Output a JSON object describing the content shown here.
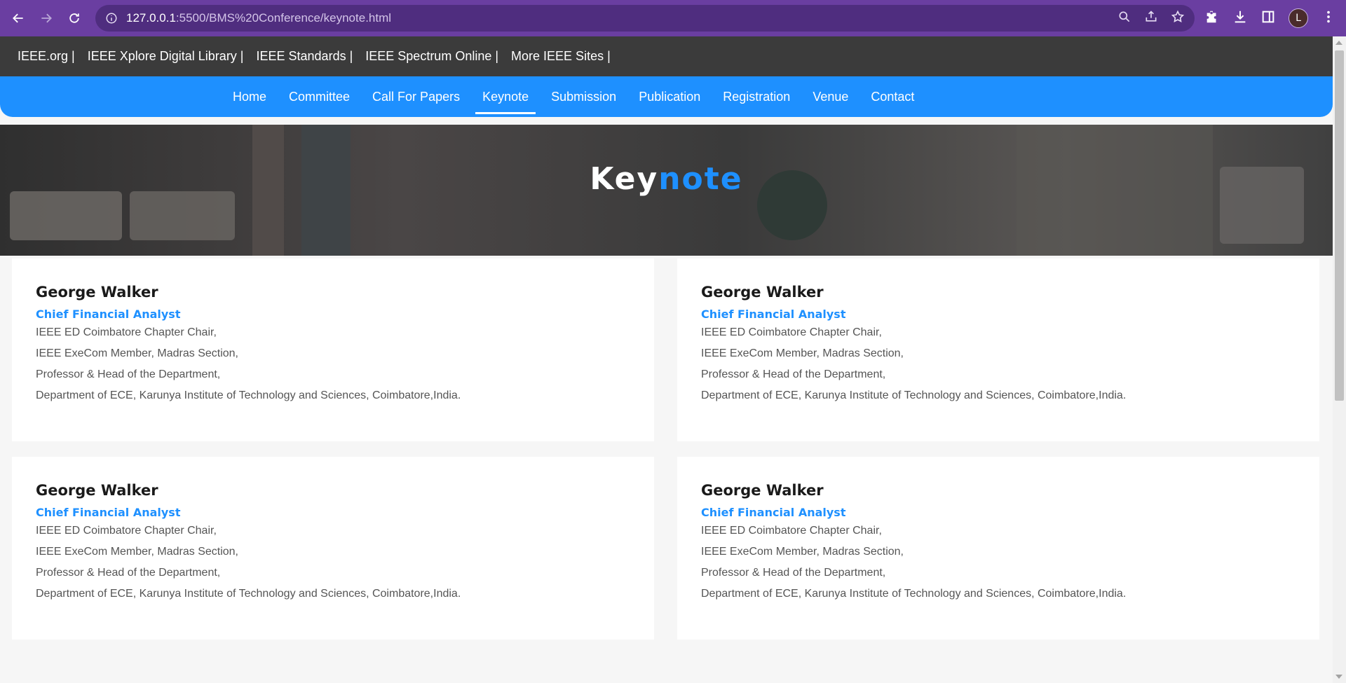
{
  "browser": {
    "url_host": "127.0.0.1",
    "url_path": ":5500/BMS%20Conference/keynote.html",
    "avatar_letter": "L"
  },
  "topbar": {
    "links": [
      "IEEE.org |",
      "IEEE Xplore Digital Library |",
      "IEEE Standards |",
      "IEEE Spectrum Online |",
      "More IEEE Sites |"
    ]
  },
  "nav": {
    "items": [
      "Home",
      "Committee",
      "Call For Papers",
      "Keynote",
      "Submission",
      "Publication",
      "Registration",
      "Venue",
      "Contact"
    ],
    "active": "Keynote"
  },
  "hero": {
    "title_white": "Key",
    "title_blue": "note"
  },
  "speakers": [
    {
      "name": "George Walker",
      "role": "Chief Financial Analyst",
      "lines": [
        "IEEE ED Coimbatore Chapter Chair,",
        "IEEE ExeCom Member, Madras Section,",
        "Professor & Head of the Department,",
        "Department of ECE, Karunya Institute of Technology and Sciences, Coimbatore,India."
      ]
    },
    {
      "name": "George Walker",
      "role": "Chief Financial Analyst",
      "lines": [
        "IEEE ED Coimbatore Chapter Chair,",
        "IEEE ExeCom Member, Madras Section,",
        "Professor & Head of the Department,",
        "Department of ECE, Karunya Institute of Technology and Sciences, Coimbatore,India."
      ]
    },
    {
      "name": "George Walker",
      "role": "Chief Financial Analyst",
      "lines": [
        "IEEE ED Coimbatore Chapter Chair,",
        "IEEE ExeCom Member, Madras Section,",
        "Professor & Head of the Department,",
        "Department of ECE, Karunya Institute of Technology and Sciences, Coimbatore,India."
      ]
    },
    {
      "name": "George Walker",
      "role": "Chief Financial Analyst",
      "lines": [
        "IEEE ED Coimbatore Chapter Chair,",
        "IEEE ExeCom Member, Madras Section,",
        "Professor & Head of the Department,",
        "Department of ECE, Karunya Institute of Technology and Sciences, Coimbatore,India."
      ]
    }
  ],
  "colors": {
    "browser_frame": "#6a3ea1",
    "topbar_bg": "#3b3b3b",
    "nav_bg": "#1e90ff",
    "accent": "#1e90ff"
  }
}
